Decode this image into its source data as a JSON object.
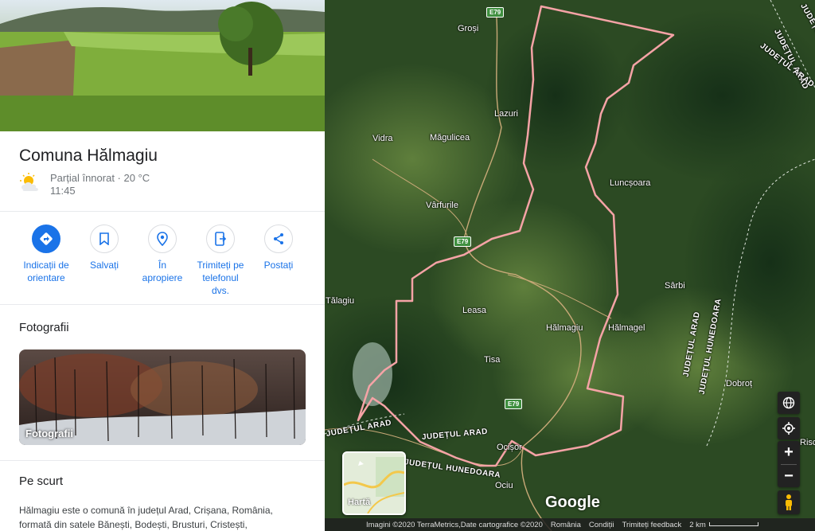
{
  "place": {
    "title": "Comuna Hălmagiu",
    "weather_condition": "Parțial înnorat · 20 °C",
    "weather_time": "11:45",
    "weather_icon": "partly-cloudy-icon"
  },
  "actions": [
    {
      "label": "Indicații de orientare",
      "icon": "directions-icon"
    },
    {
      "label": "Salvați",
      "icon": "bookmark-icon"
    },
    {
      "label": "În apropiere",
      "icon": "nearby-icon"
    },
    {
      "label": "Trimiteți pe telefonul dvs.",
      "icon": "send-to-phone-icon"
    },
    {
      "label": "Postați",
      "icon": "share-icon"
    }
  ],
  "photos": {
    "section_title": "Fotografii",
    "card_caption": "Fotografii"
  },
  "summary": {
    "section_title": "Pe scurt",
    "text": "Hălmagiu este o comună în județul Arad, Crișana, România, formată din satele Bănești, Bodești, Brusturi, Cristești,"
  },
  "map": {
    "places": [
      "Groși",
      "Lazuri",
      "Vidra",
      "Măgulicea",
      "Vârfurile",
      "Luncșoara",
      "Tălagiu",
      "Leasa",
      "Hălmagiu",
      "Hălmagel",
      "Sârbi",
      "Tisa",
      "Dobroț",
      "Ocișor",
      "Ociu",
      "Risc"
    ],
    "road_labels": [
      "JUDEȚUL ARAD",
      "JUDEȚUL ARAD",
      "JUDEȚUL HUNEDOARA",
      "JUDEȚUL ARAD",
      "JUDEȚUL HUNEDOARA",
      "JUDEȚUL ARAD",
      "JUDEȚUL HUNEDOARA",
      "JUDEȚUL ARAD"
    ],
    "shields": [
      "E79",
      "E79",
      "E79"
    ],
    "layer_label": "Hartă",
    "logo": "Google",
    "footer": {
      "imagery": "Imagini ©2020 TerraMetrics,Date cartografice ©2020",
      "country": "România",
      "terms": "Condiții",
      "feedback": "Trimiteți feedback",
      "scale": "2 km"
    },
    "controls": {
      "zoom_in": "+",
      "zoom_out": "−"
    }
  },
  "colors": {
    "accent": "#1a73e8",
    "boundary": "#f5a3a6",
    "map_bg": "#27431f"
  }
}
